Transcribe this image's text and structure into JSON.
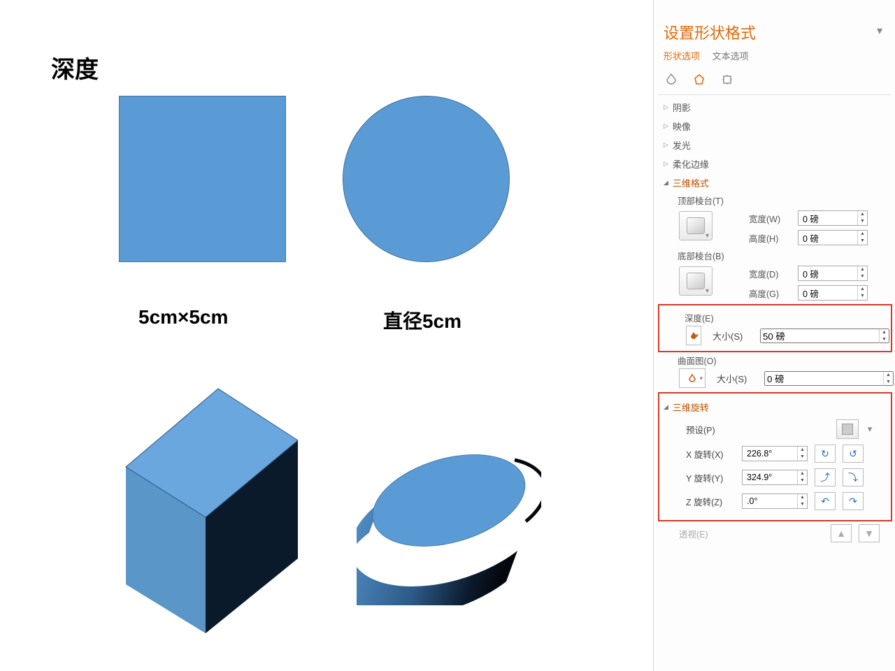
{
  "canvas": {
    "title": "深度",
    "square_label": "5cm×5cm",
    "circle_label": "直径5cm"
  },
  "panel": {
    "title": "设置形状格式",
    "tabs": {
      "shape": "形状选项",
      "text": "文本选项"
    },
    "sections": {
      "shadow": "阴影",
      "reflection": "映像",
      "glow": "发光",
      "softedge": "柔化边缘",
      "format3d": "三维格式",
      "rotation3d": "三维旋转"
    },
    "bevel": {
      "top_label": "顶部棱台(T)",
      "bottom_label": "底部棱台(B)",
      "width_label": "宽度(W)",
      "height_label": "高度(H)",
      "width_d_label": "宽度(D)",
      "height_g_label": "高度(G)",
      "top_width": "0 磅",
      "top_height": "0 磅",
      "bottom_width": "0 磅",
      "bottom_height": "0 磅"
    },
    "depth": {
      "label": "深度(E)",
      "size_label": "大小(S)",
      "size_value": "50 磅"
    },
    "contour": {
      "label": "曲面图(O)",
      "size_label": "大小(S)",
      "size_value": "0 磅"
    },
    "rotation": {
      "preset_label": "预设(P)",
      "x_label": "X 旋转(X)",
      "y_label": "Y 旋转(Y)",
      "z_label": "Z 旋转(Z)",
      "x_value": "226.8°",
      "y_value": "324.9°",
      "z_value": ".0°",
      "perspective_label": "透视(E)"
    }
  }
}
